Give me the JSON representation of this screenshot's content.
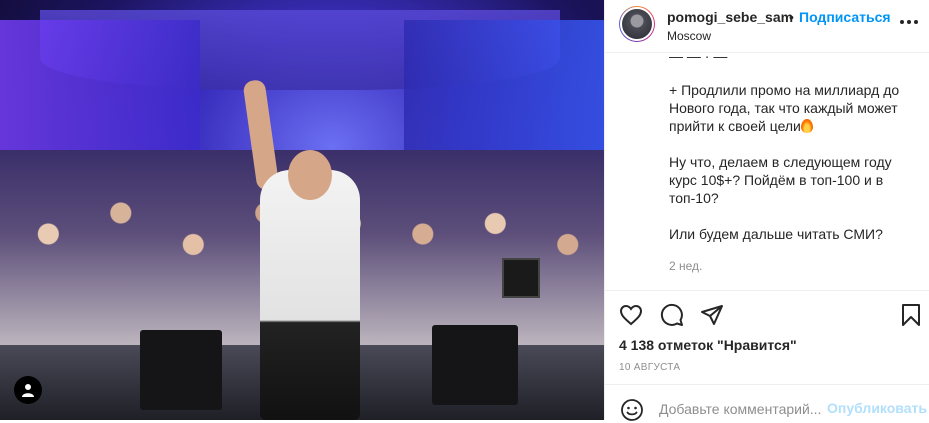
{
  "post": {
    "username": "pomogi_sebe_sam",
    "dot": "•",
    "follow_label": "Подписаться",
    "location": "Moscow",
    "caption_cut": "—  —  ·  —",
    "caption_lines": [
      "+ Продлили промо на миллиард до Нового года, так что каждый может прийти к своей цели",
      "Ну что, делаем в следующем году курс 10$+? Пойдём в топ-100 и в топ-10?",
      "Или будем дальше читать СМИ?"
    ],
    "time_ago": "2 нед.",
    "likes": "4 138 отметок \"Нравится\"",
    "date": "10 АВГУСТА"
  },
  "comment": {
    "placeholder": "Добавьте комментарий...",
    "publish_label": "Опубликовать"
  },
  "icons": {
    "more": "more-icon",
    "like": "heart-icon",
    "comment": "comment-icon",
    "share": "share-icon",
    "save": "bookmark-icon",
    "emoji": "emoji-icon",
    "user_tag": "user-tag-icon"
  },
  "colors": {
    "accent": "#0095f6",
    "muted": "#8e8e8e",
    "publish_disabled": "#b2dffc"
  }
}
